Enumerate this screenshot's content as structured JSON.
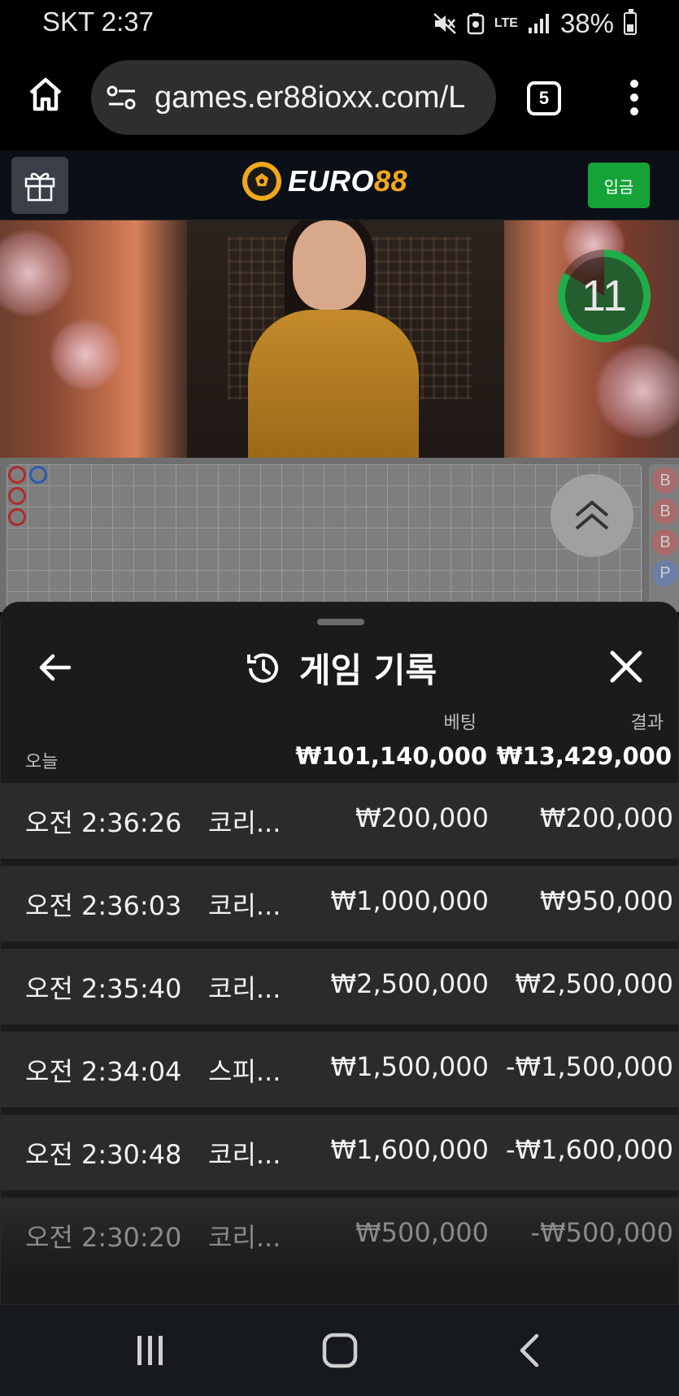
{
  "status_bar": {
    "carrier_time": "SKT 2:37",
    "network": "LTE",
    "battery": "38%"
  },
  "browser": {
    "url": "games.er88ioxx.com/L",
    "tab_count": "5"
  },
  "site": {
    "logo_part1": "EURO",
    "logo_part2": "88",
    "deposit_label": "입금"
  },
  "video": {
    "countdown": "11"
  },
  "roadmap": {
    "beads": [
      "B",
      "B",
      "B",
      "P"
    ],
    "side_road": [
      "B",
      "B",
      "B",
      "P"
    ]
  },
  "history": {
    "title": "게임 기록",
    "col_bet": "베팅",
    "col_result": "결과",
    "today_label": "오늘",
    "total_bet": "₩101,140,000",
    "total_result": "₩13,429,000",
    "rows": [
      {
        "time": "오전 2:36:26",
        "game": "코리...",
        "bet": "₩200,000",
        "result": "₩200,000"
      },
      {
        "time": "오전 2:36:03",
        "game": "코리...",
        "bet": "₩1,000,000",
        "result": "₩950,000"
      },
      {
        "time": "오전 2:35:40",
        "game": "코리...",
        "bet": "₩2,500,000",
        "result": "₩2,500,000"
      },
      {
        "time": "오전 2:34:04",
        "game": "스피...",
        "bet": "₩1,500,000",
        "result": "-₩1,500,000"
      },
      {
        "time": "오전 2:30:48",
        "game": "코리...",
        "bet": "₩1,600,000",
        "result": "-₩1,600,000"
      },
      {
        "time": "오전 2:30:20",
        "game": "코리...",
        "bet": "₩500,000",
        "result": "-₩500,000"
      }
    ]
  },
  "colors": {
    "deposit_green": "#15a337",
    "brand_gold": "#f2a81c",
    "timer_green": "#1fae4a"
  }
}
